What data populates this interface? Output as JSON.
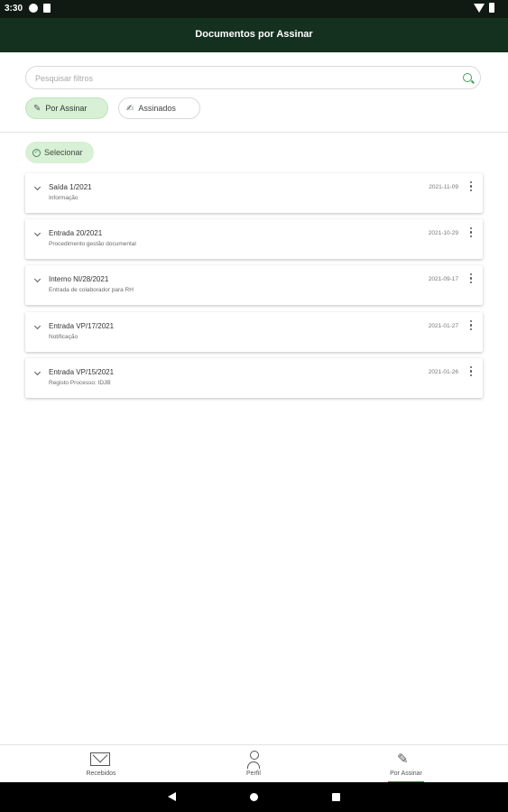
{
  "status_bar": {
    "time": "3:30"
  },
  "app_bar": {
    "title": "Documentos por Assinar"
  },
  "search": {
    "placeholder": "Pesquisar filtros"
  },
  "filters": {
    "por_assinar": "Por Assinar",
    "assinados": "Assinados"
  },
  "select_label": "Selecionar",
  "documents": [
    {
      "title": "Saída 1/2021",
      "subtitle": "Informação",
      "date": "2021-11-09"
    },
    {
      "title": "Entrada 20/2021",
      "subtitle": "Procedimento gestão documental",
      "date": "2021-10-29"
    },
    {
      "title": "Interno NI/28/2021",
      "subtitle": "Entrada de colaborador para RH",
      "date": "2021-09-17"
    },
    {
      "title": "Entrada VP/17/2021",
      "subtitle": "Notificação",
      "date": "2021-01-27"
    },
    {
      "title": "Entrada VP/15/2021",
      "subtitle": "Registo Processo: IDJB",
      "date": "2021-01-26"
    }
  ],
  "bottom_nav": {
    "recebidos": "Recebidos",
    "perfil": "Perfil",
    "por_assinar": "Por Assinar"
  },
  "colors": {
    "app_bar": "#14301f",
    "accent": "#2a8a44",
    "chip_active": "#d8f0d5"
  }
}
